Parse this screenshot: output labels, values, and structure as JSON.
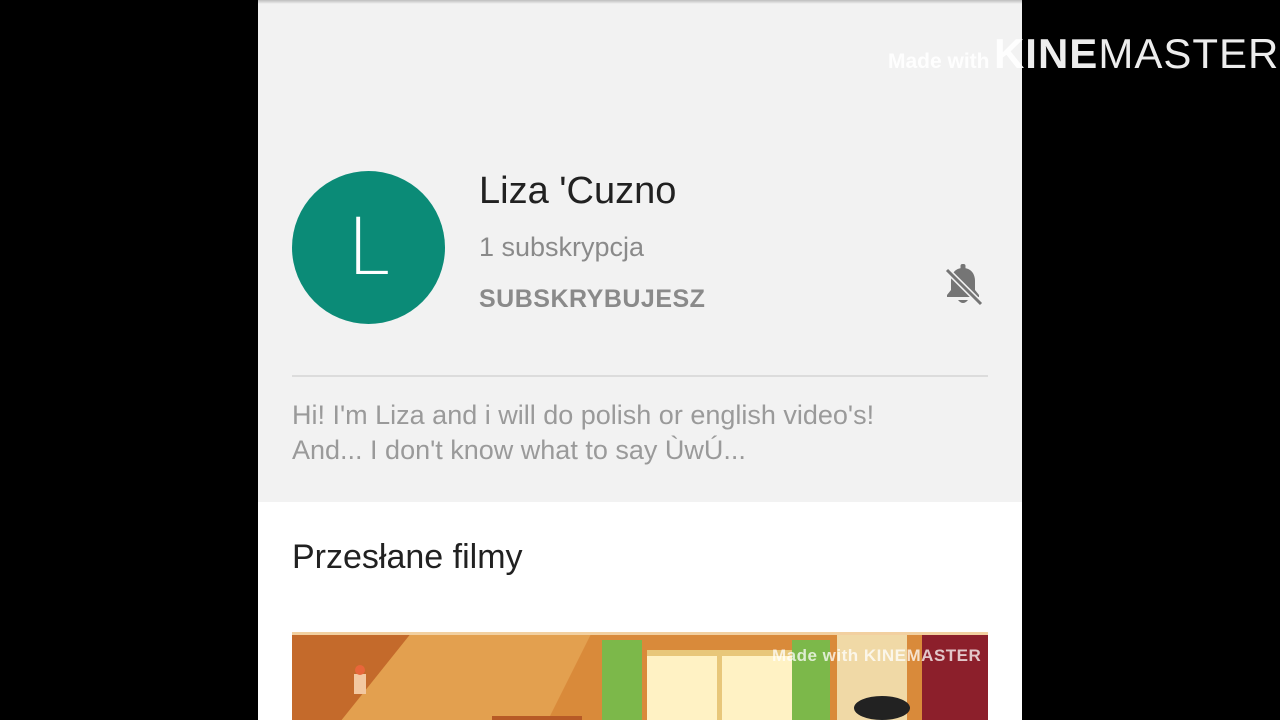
{
  "channel": {
    "avatar_letter": "L",
    "avatar_color": "#0b8b77",
    "name": "Liza 'Cuzno",
    "subscriptions": "1 subskrypcja",
    "subscribe_state_label": "SUBSKRYBUJESZ",
    "notification_icon": "bell-off-icon",
    "description_line1": "Hi! I'm Liza and i will do polish or english video's!",
    "description_line2": "And... I don't know what to say ÙwÚ..."
  },
  "uploads": {
    "title": "Przesłane filmy",
    "thumbnail_watermark": "Made with KINEMASTER"
  },
  "watermark": {
    "made_with": "Made with",
    "kine": "KINE",
    "master": "MASTER"
  }
}
